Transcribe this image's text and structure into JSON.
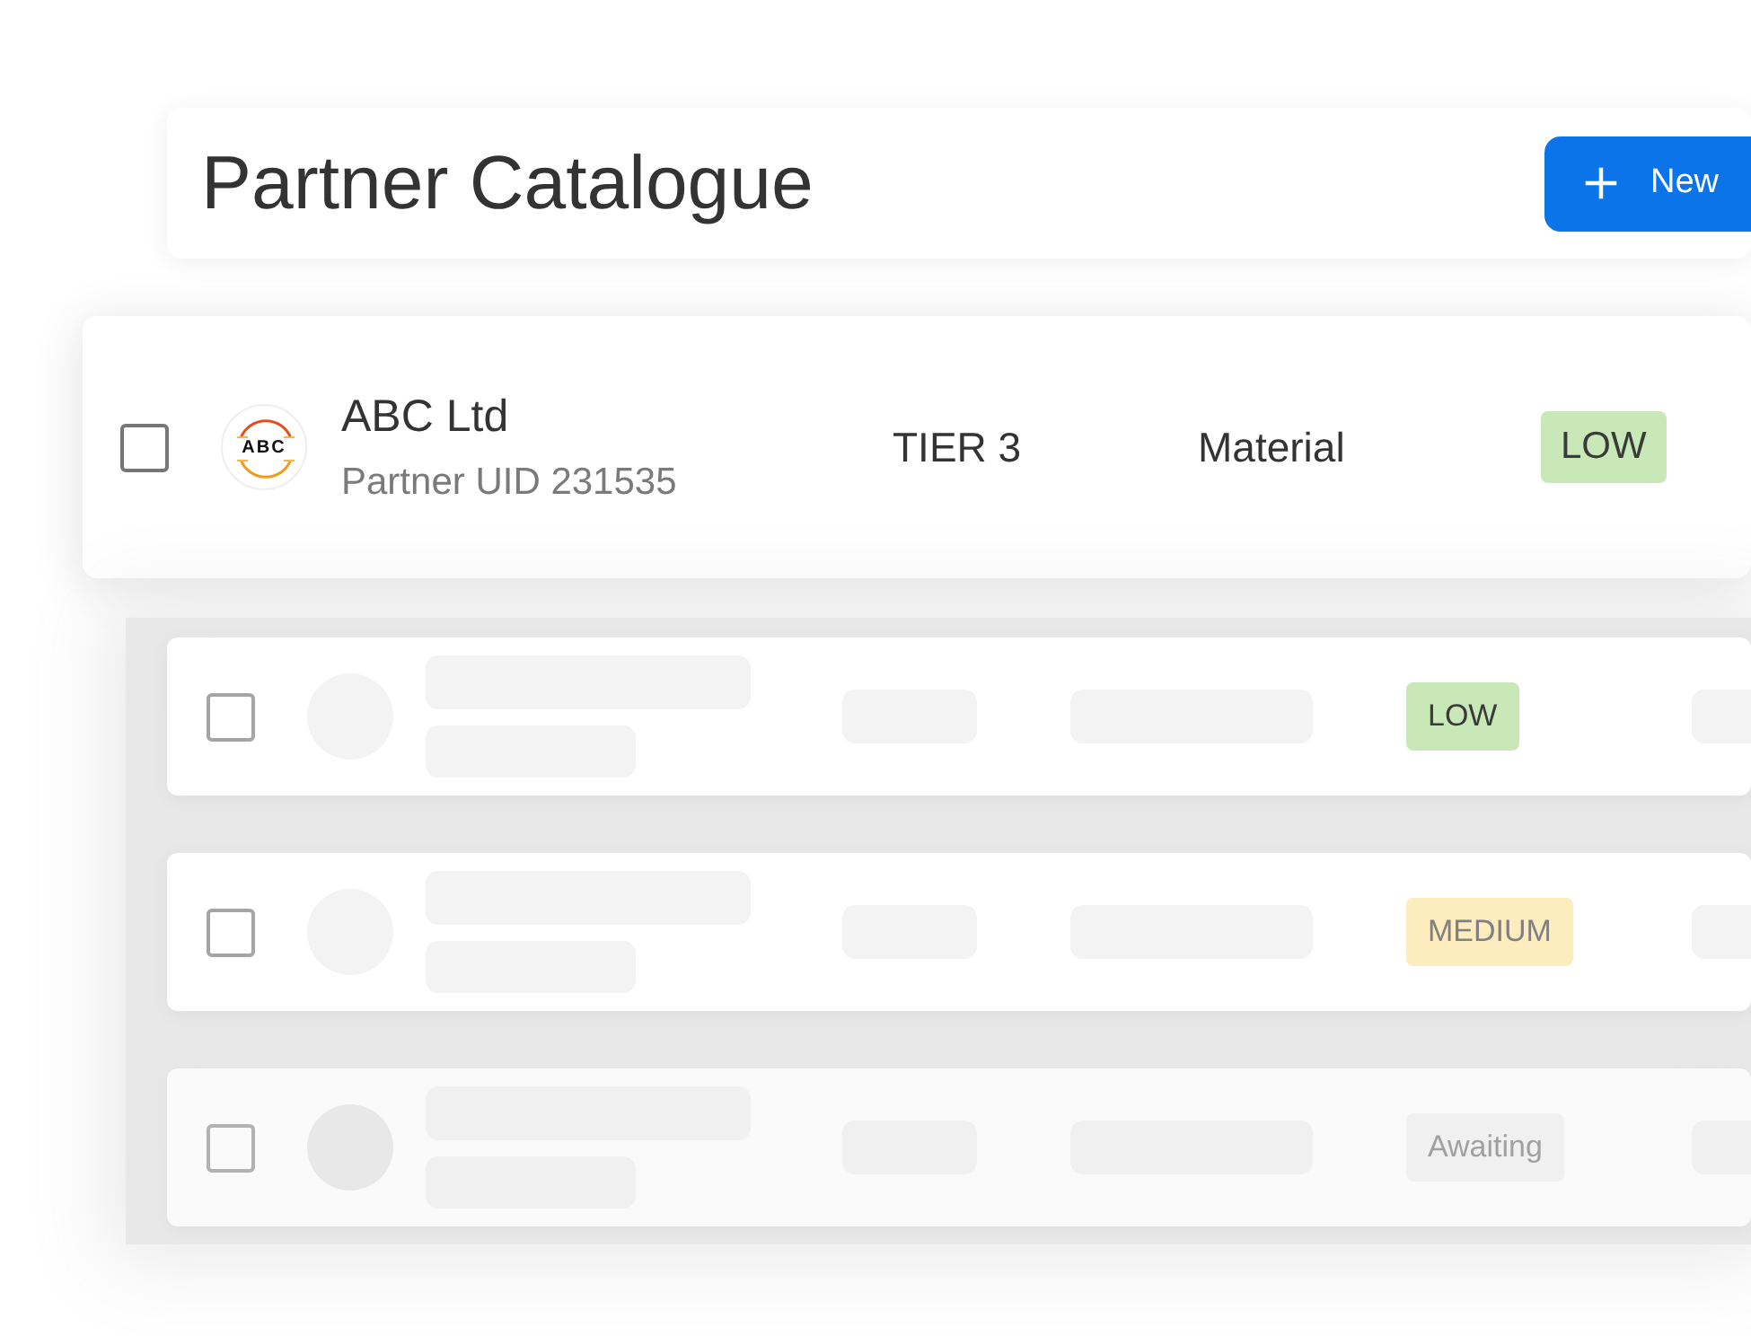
{
  "header": {
    "title": "Partner Catalogue",
    "new_button": {
      "label": "New"
    }
  },
  "featured_partner": {
    "checked": false,
    "logo_text": "ABC",
    "name": "ABC Ltd",
    "uid": "Partner UID 231535",
    "tier": "TIER 3",
    "category": "Material",
    "risk": {
      "label": "LOW",
      "kind": "low"
    }
  },
  "placeholder_rows": [
    {
      "checked": false,
      "dimmed": false,
      "risk": {
        "label": "LOW",
        "kind": "low"
      }
    },
    {
      "checked": false,
      "dimmed": false,
      "risk": {
        "label": "MEDIUM",
        "kind": "medium"
      }
    },
    {
      "checked": false,
      "dimmed": true,
      "risk": {
        "label": "Awaiting",
        "kind": "awaiting"
      }
    }
  ]
}
